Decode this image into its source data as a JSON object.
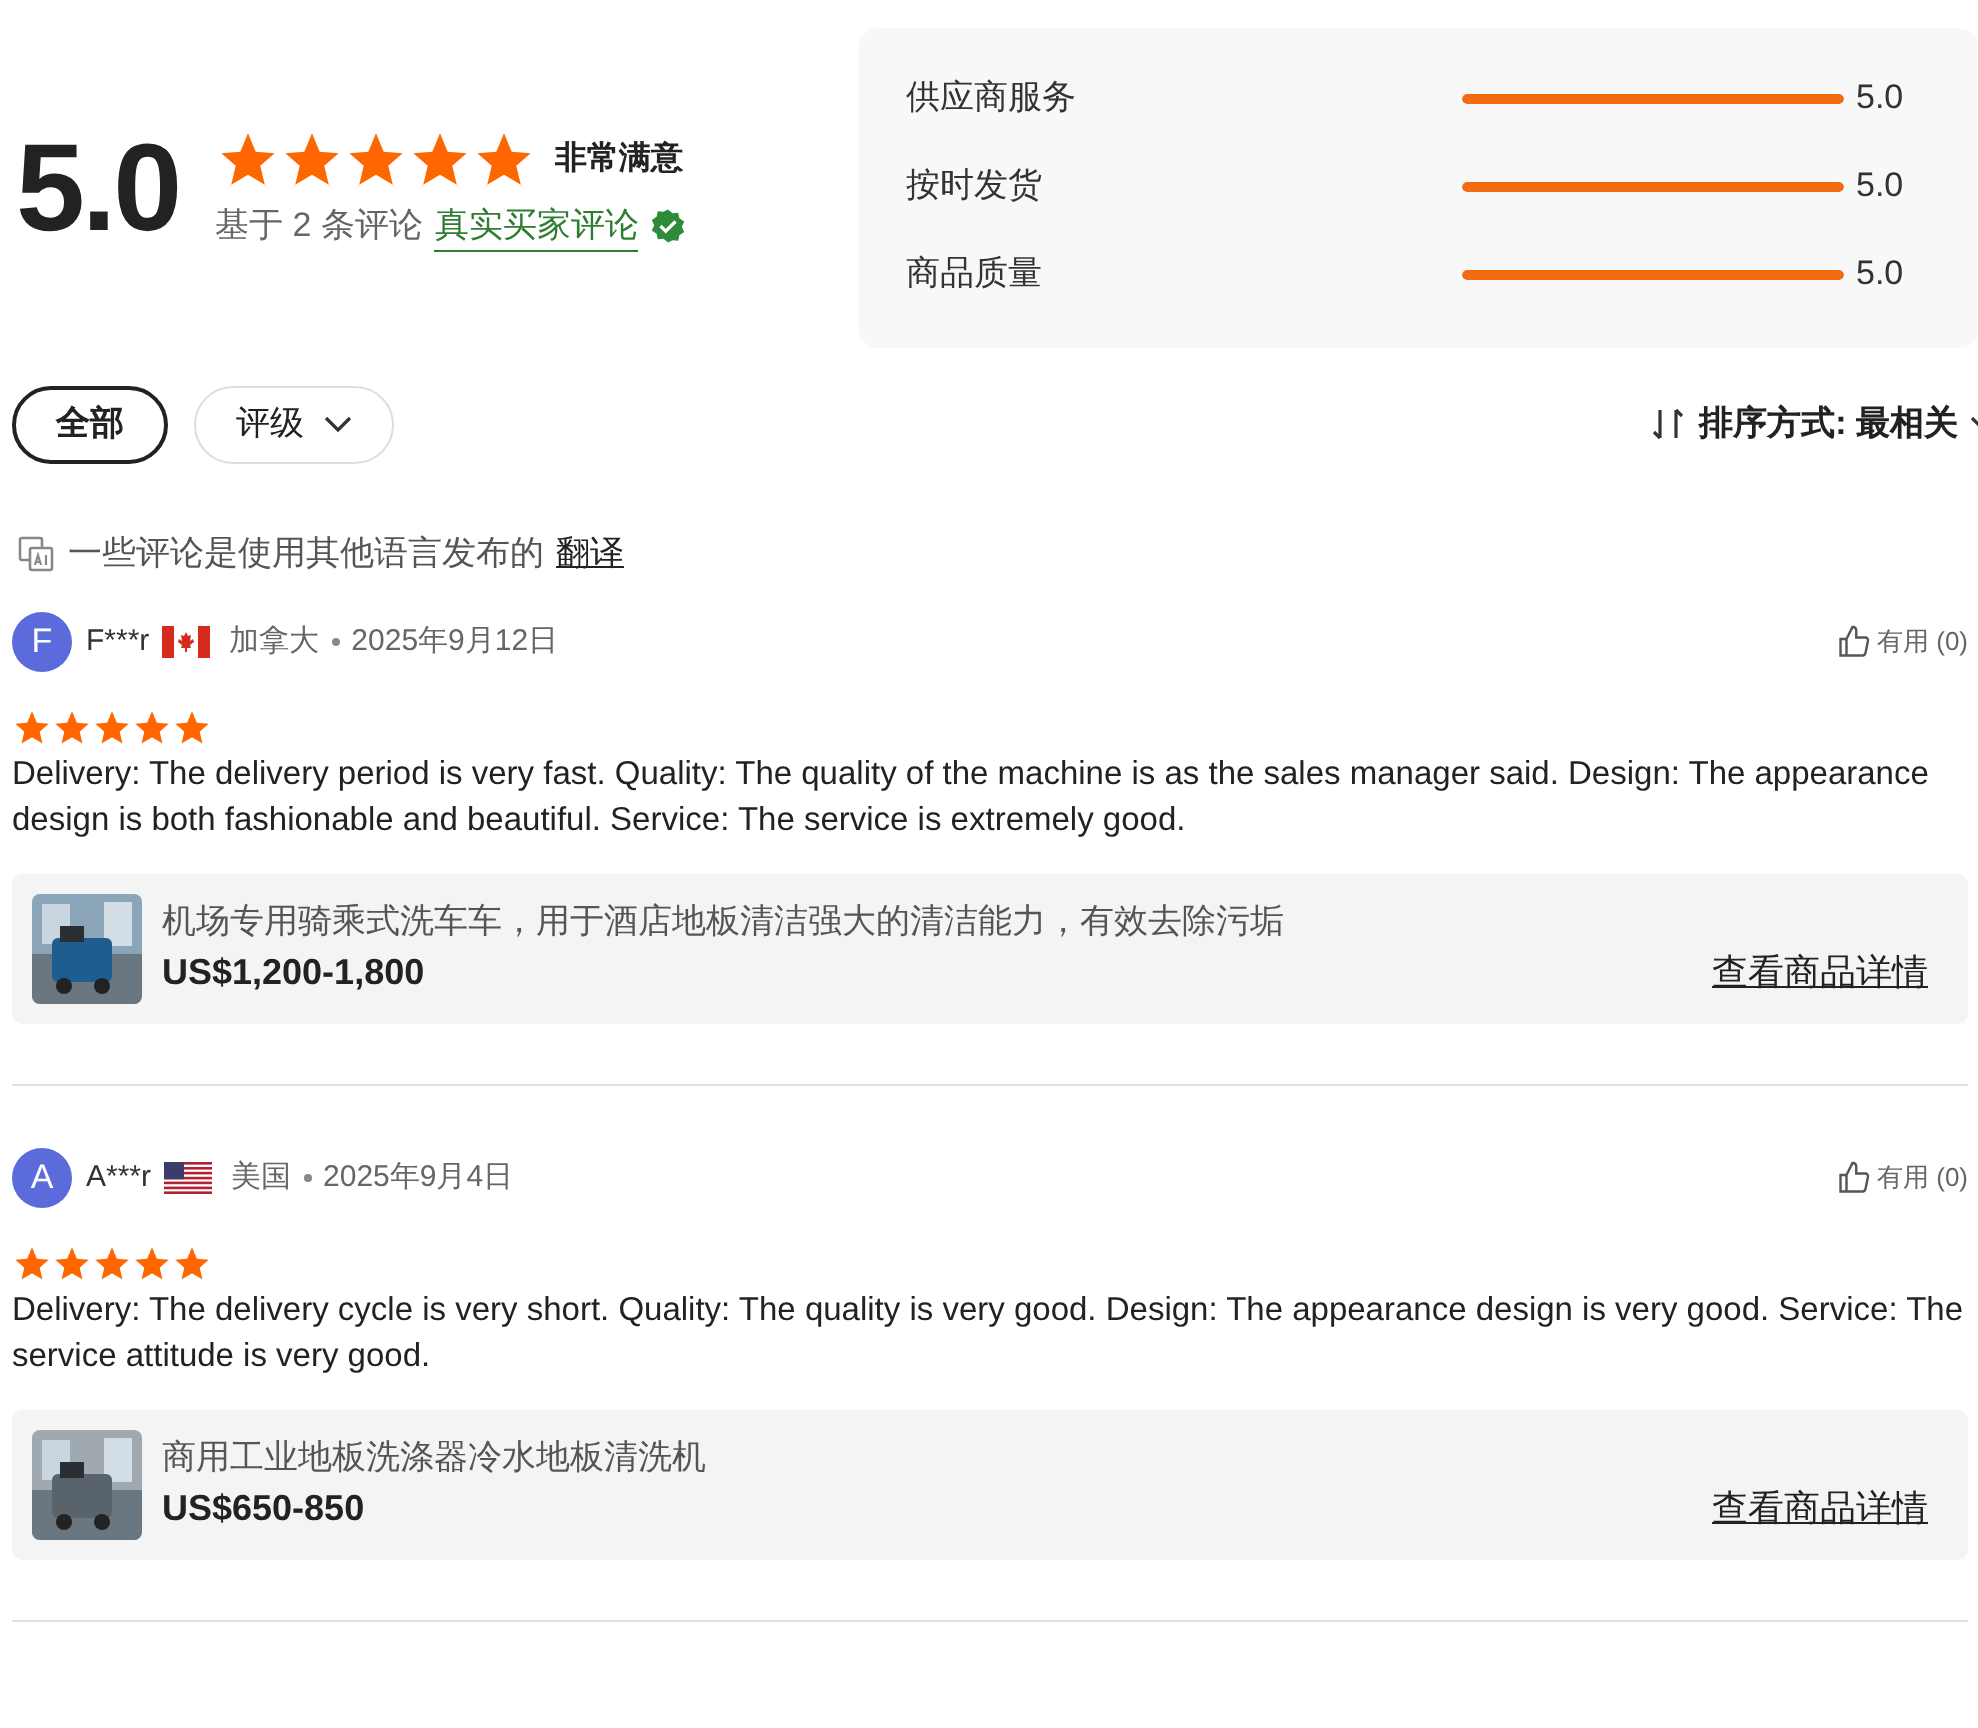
{
  "summary": {
    "score": "5.0",
    "stars": 5,
    "verdict": "非常满意",
    "based_on": "基于 2 条评论",
    "verified_link": "真实买家评论"
  },
  "sub_ratings": [
    {
      "label": "供应商服务",
      "level": 1,
      "value": "5.0"
    },
    {
      "label": "按时发货",
      "level": 1,
      "value": "5.0"
    },
    {
      "label": "商品质量",
      "level": 1,
      "value": "5.0"
    }
  ],
  "filters": [
    {
      "label": "全部",
      "selected": true,
      "dropdown": false
    },
    {
      "label": "评级",
      "selected": false,
      "dropdown": true
    }
  ],
  "sort": {
    "label": "排序方式: 最相关"
  },
  "translate_notice": {
    "text": "一些评论是使用其他语言发布的",
    "link": "翻译"
  },
  "reviews": [
    {
      "initial": "F",
      "name": "F***r",
      "country": "加拿大",
      "flag": {
        "kind": "canada"
      },
      "date": "2025年9月12日",
      "helpful": "有用 (0)",
      "stars": 5,
      "text": "Delivery: The delivery period is very fast. Quality: The quality of the machine is as the sales manager said. Design: The appearance design is both fashionable and beautiful. Service: The service is extremely good.",
      "product": {
        "title": "机场专用骑乘式洗车车，用于酒店地板清洁强大的清洁能力，有效去除污垢",
        "price": "US$1,200-1,800",
        "link": "查看商品详情"
      }
    },
    {
      "initial": "A",
      "name": "A***r",
      "country": "美国",
      "flag": {
        "kind": "usa"
      },
      "date": "2025年9月4日",
      "helpful": "有用 (0)",
      "stars": 5,
      "text": "Delivery: The delivery cycle is very short. Quality: The quality is very good. Design: The appearance design is very good. Service: The service attitude is very good.",
      "product": {
        "title": "商用工业地板洗涤器冷水地板清洗机",
        "price": "US$650-850",
        "link": "查看商品详情"
      }
    }
  ]
}
